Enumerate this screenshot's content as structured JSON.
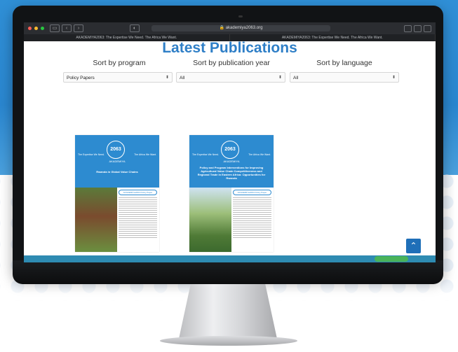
{
  "browser": {
    "url": "akademiya2063.org",
    "tabs": [
      "AKADEMIYA2063: The Expertise We Need. The Africa We Want.",
      "AKADEMIYA2063: The Expertise We Need. The Africa We Want."
    ]
  },
  "page": {
    "title": "Latest Publications",
    "filters": [
      {
        "label": "Sort by program",
        "value": "Policy Papers"
      },
      {
        "label": "Sort by publication year",
        "value": "All"
      },
      {
        "label": "Sort by language",
        "value": "All"
      }
    ]
  },
  "publications": [
    {
      "brand": "AKADEMIYA",
      "tagline_left": "The Expertise We Need.",
      "tagline_right": "The Africa We Want.",
      "title": "Rwanda in Global Value Chains",
      "badge": "AKADEMIYA2063 Policy Paper"
    },
    {
      "brand": "AKADEMIYA",
      "tagline_left": "The Expertise We Need.",
      "tagline_right": "The Africa We Want.",
      "title": "Policy and Program Interventions for Improving Agricultural Value Chain Competitiveness and Regional Trade in Eastern Africa: Opportunities for Rwanda",
      "badge": "AKADEMIYA2063 Policy Paper"
    }
  ],
  "logo_text": "2063",
  "colors": {
    "accent": "#2f7fc7",
    "cover_blue": "#2d8bd0",
    "cookie_bar": "#2e8bb2",
    "cookie_button": "#49b35a"
  }
}
